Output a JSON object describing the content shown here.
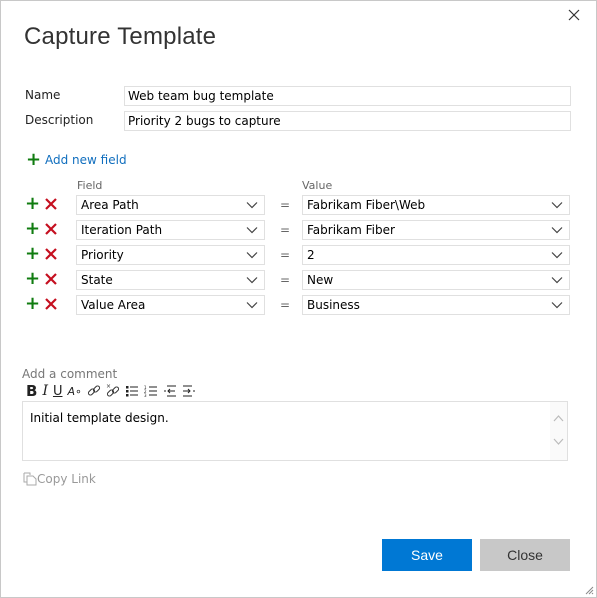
{
  "dialog": {
    "title": "Capture Template",
    "close_icon": "close-icon"
  },
  "form": {
    "name_label": "Name",
    "name_value": "Web team bug template",
    "description_label": "Description",
    "description_value": "Priority 2 bugs to capture"
  },
  "fields": {
    "add_new_field_label": "Add new field",
    "field_header": "Field",
    "value_header": "Value",
    "operator": "=",
    "rows": [
      {
        "field": "Area Path",
        "value": "Fabrikam Fiber\\Web"
      },
      {
        "field": "Iteration Path",
        "value": "Fabrikam Fiber"
      },
      {
        "field": "Priority",
        "value": "2"
      },
      {
        "field": "State",
        "value": "New"
      },
      {
        "field": "Value Area",
        "value": "Business"
      }
    ]
  },
  "comment": {
    "label": "Add a comment",
    "toolbar": [
      "bold-icon",
      "italic-icon",
      "underline-icon",
      "highlight-icon",
      "link-icon",
      "unlink-icon",
      "bulleted-list-icon",
      "numbered-list-icon",
      "decrease-indent-icon",
      "increase-indent-icon"
    ],
    "text": "Initial template design."
  },
  "copy_link_label": "Copy Link",
  "buttons": {
    "save": "Save",
    "close": "Close"
  },
  "colors": {
    "primary": "#0078d4",
    "add_green": "#107c10",
    "delete_red": "#c50f1f",
    "link_blue": "#106ebe"
  }
}
